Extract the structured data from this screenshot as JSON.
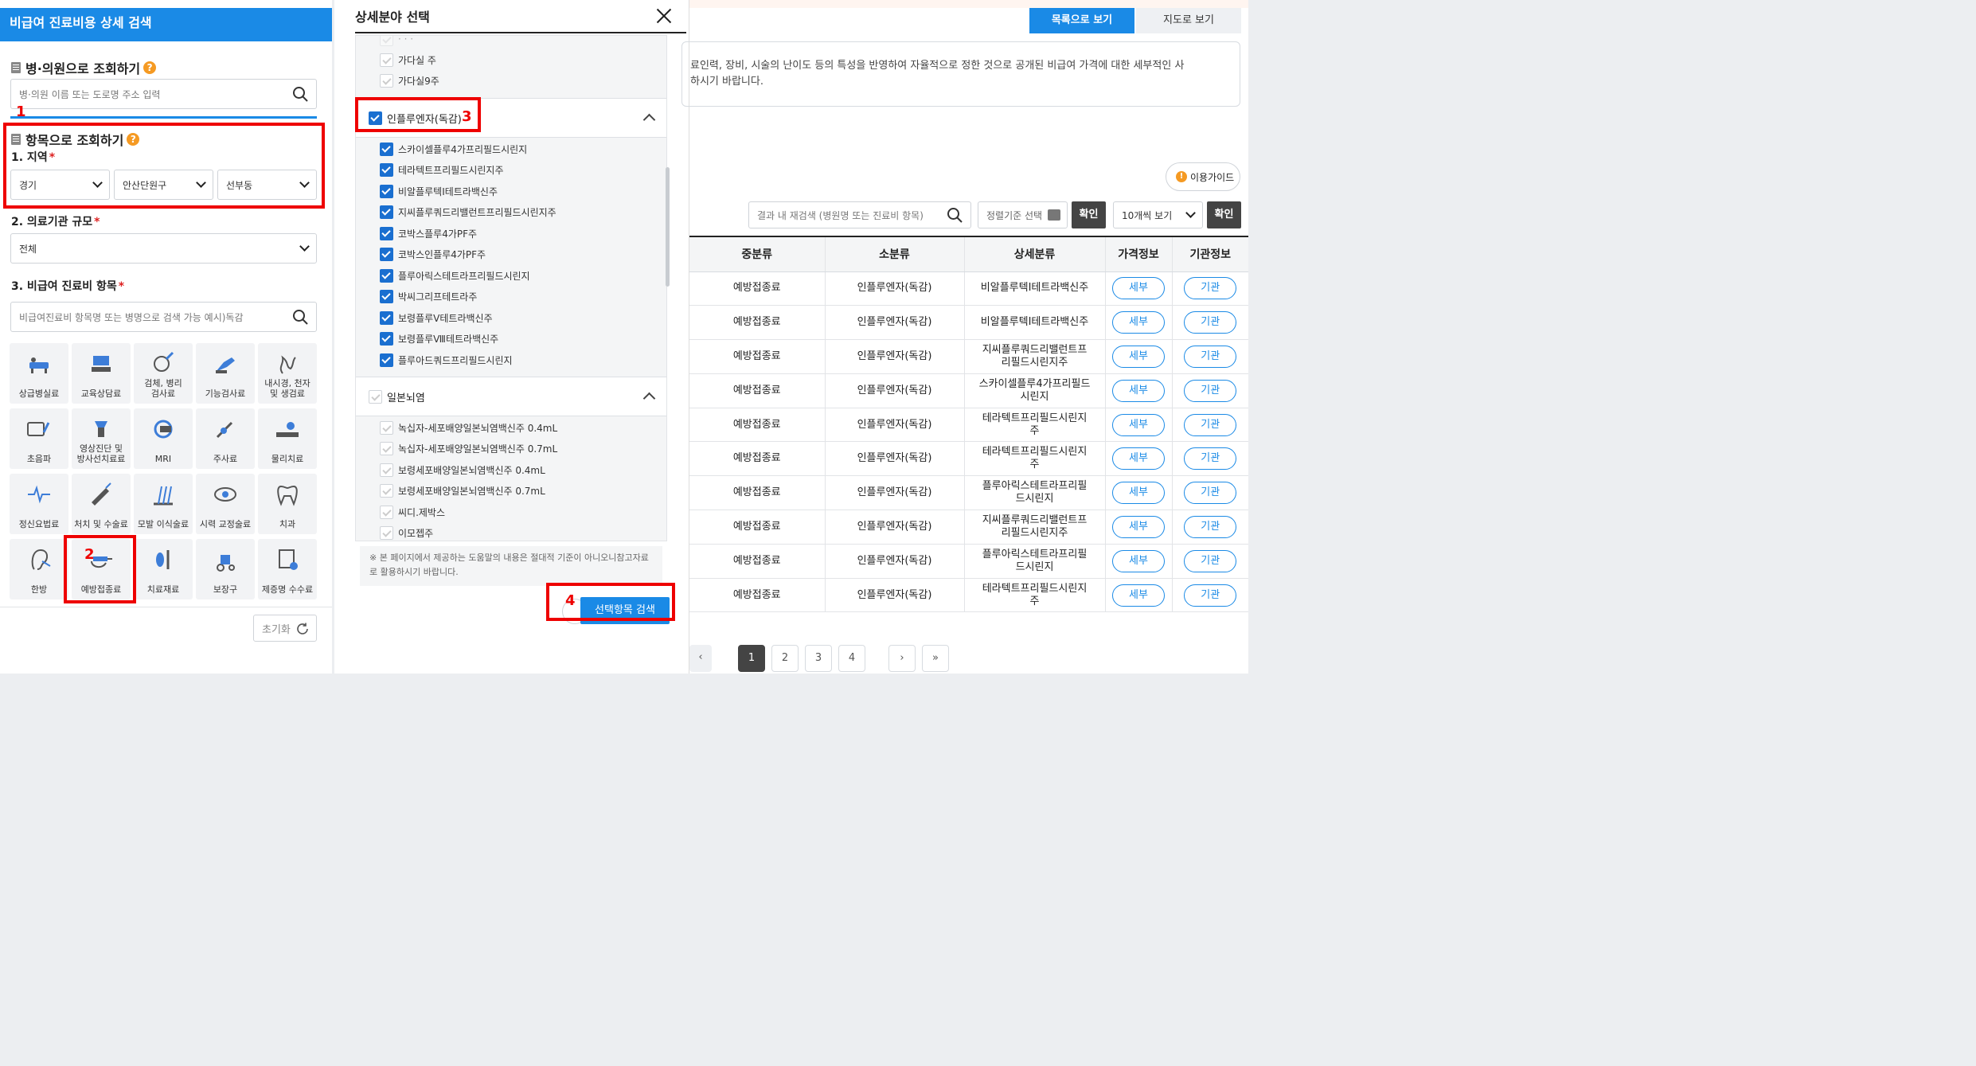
{
  "left": {
    "header": "비급여 진료비용 상세 검색",
    "hospital_section": "병·의원으로 조회하기",
    "hospital_placeholder": "병·의원 이름 또는 도로명 주소 입력",
    "item_section": "항목으로 조회하기",
    "region_label": "1. 지역",
    "region": [
      "경기",
      "안산단원구",
      "선부동"
    ],
    "scale_label": "2. 의료기관 규모",
    "scale_value": "전체",
    "item_label": "3. 비급여 진료비 항목",
    "item_placeholder": "비급여진료비 항목명 또는 병명으로 검색 가능 예시)독감",
    "tiles": [
      [
        "상급병실료"
      ],
      [
        "교육상담료"
      ],
      [
        "검체, 병리",
        "검사료"
      ],
      [
        "기능검사료"
      ],
      [
        "내시경, 천자",
        "및 생검료"
      ],
      [
        "초음파"
      ],
      [
        "영상진단 및",
        "방사선치료료"
      ],
      [
        "MRI"
      ],
      [
        "주사료"
      ],
      [
        "물리치료"
      ],
      [
        "정신요법료"
      ],
      [
        "처치 및 수술료"
      ],
      [
        "모발 이식술료"
      ],
      [
        "시력 교정술료"
      ],
      [
        "치과"
      ],
      [
        "한방"
      ],
      [
        "예방접종료"
      ],
      [
        "치료재료"
      ],
      [
        "보장구"
      ],
      [
        "제증명 수수료"
      ]
    ],
    "reset": "초기화",
    "annot": [
      "1",
      "2"
    ]
  },
  "modal": {
    "title": "상세분야 선택",
    "top_items": [
      "가다실 주",
      "가다실9주"
    ],
    "group1": "인플루엔자(독감)",
    "group1_items": [
      "스카이셀플루4가프리필드시린지",
      "테라텍트프리필드시린지주",
      "비알플루텍I테트라백신주",
      "지씨플루쿼드리밸런트프리필드시린지주",
      "코박스플루4가PF주",
      "코박스인플루4가PF주",
      "플루아릭스테트라프리필드시린지",
      "박씨그리프테트라주",
      "보령플루Ⅴ테트라백신주",
      "보령플루Ⅷ테트라백신주",
      "플루아드쿼드프리필드시린지"
    ],
    "group2": "일본뇌염",
    "group2_items": [
      "녹십자-세포배양일본뇌염백신주 0.4mL",
      "녹십자-세포배양일본뇌염백신주 0.7mL",
      "보령세포배양일본뇌염백신주 0.4mL",
      "보령세포배양일본뇌염백신주 0.7mL",
      "씨디.제박스",
      "이모젭주"
    ],
    "note": "※ 본 페이지에서 제공하는 도움말의 내용은 절대적 기준이 아니오니참고자료로 활용하시기 바랍니다.",
    "search_btn": "선택항목 검색",
    "annot": [
      "3",
      "4"
    ]
  },
  "right": {
    "btn_list": "목록으로 보기",
    "btn_map": "지도로 보기",
    "desc1": "료인력, 장비, 시술의 난이도 등의 특성을 반영하여 자율적으로 정한 것으로 공개된 비급여 가격에 대한 세부적인 사",
    "desc2": "하시기 바랍니다.",
    "guide": "이용가이드",
    "inner_search_placeholder": "결과 내 재검색 (병원명 또는 진료비 항목)",
    "sort_label": "정렬기준 선택",
    "confirm": "확인",
    "per_page": "10개씩 보기",
    "columns": [
      "중분류",
      "소분류",
      "상세분류",
      "가격정보",
      "기관정보"
    ],
    "rows": [
      [
        "예방접종료",
        "인플루엔자(독감)",
        "비알플루텍I테트라백신주"
      ],
      [
        "예방접종료",
        "인플루엔자(독감)",
        "비알플루텍I테트라백신주"
      ],
      [
        "예방접종료",
        "인플루엔자(독감)",
        "지씨플루쿼드리밸런트프|리필드시린지주"
      ],
      [
        "예방접종료",
        "인플루엔자(독감)",
        "스카이셀플루4가프리필드|시린지"
      ],
      [
        "예방접종료",
        "인플루엔자(독감)",
        "테라텍트프리필드시린지|주"
      ],
      [
        "예방접종료",
        "인플루엔자(독감)",
        "테라텍트프리필드시린지|주"
      ],
      [
        "예방접종료",
        "인플루엔자(독감)",
        "플루아릭스테트라프리필|드시린지"
      ],
      [
        "예방접종료",
        "인플루엔자(독감)",
        "지씨플루쿼드리밸런트프|리필드시린지주"
      ],
      [
        "예방접종료",
        "인플루엔자(독감)",
        "플루아릭스테트라프리필|드시린지"
      ],
      [
        "예방접종료",
        "인플루엔자(독감)",
        "테라텍트프리필드시린지|주"
      ]
    ],
    "detail": "세부",
    "org": "기관",
    "pages": [
      "1",
      "2",
      "3",
      "4"
    ]
  },
  "colors": {
    "accent": "#1a8ae6",
    "annotation": "#e00000",
    "check": "#1a6fd0"
  }
}
